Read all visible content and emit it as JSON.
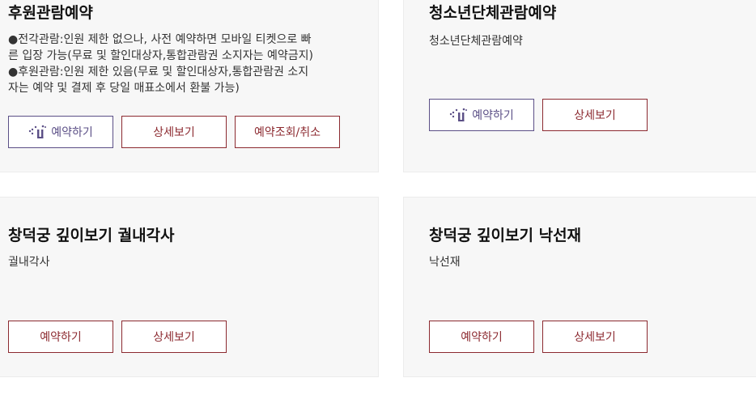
{
  "colors": {
    "ticket_accent": "#5b4f86",
    "red_accent": "#8c2a30",
    "card_bg": "#f7f7f7"
  },
  "cards": [
    {
      "title": "후원관람예약",
      "desc_lines": [
        "●전각관람:인원 제한 없으나, 사전 예약하면 모바일 티켓으로 빠",
        "른 입장 가능(무료 및 할인대상자,통합관람권 소지자는 예약금지)",
        "●후원관람:인원 제한 있음(무료 및 할인대상자,통합관람권 소지",
        "자는 예약 및 결제 후 당일 매표소에서 환불 가능)"
      ],
      "buttons": [
        "예약하기",
        "상세보기",
        "예약조회/취소"
      ],
      "ticket_icon": "mobile-ticket-icon"
    },
    {
      "title": "청소년단체관람예약",
      "desc_lines": [
        "청소년단체관람예약"
      ],
      "buttons": [
        "예약하기",
        "상세보기"
      ],
      "ticket_icon": "mobile-ticket-icon"
    },
    {
      "title": "창덕궁 깊이보기 궐내각사",
      "desc_lines": [
        "궐내각사"
      ],
      "buttons": [
        "예약하기",
        "상세보기"
      ]
    },
    {
      "title": "창덕궁 깊이보기 낙선재",
      "desc_lines": [
        "낙선재"
      ],
      "buttons": [
        "예약하기",
        "상세보기"
      ]
    }
  ]
}
